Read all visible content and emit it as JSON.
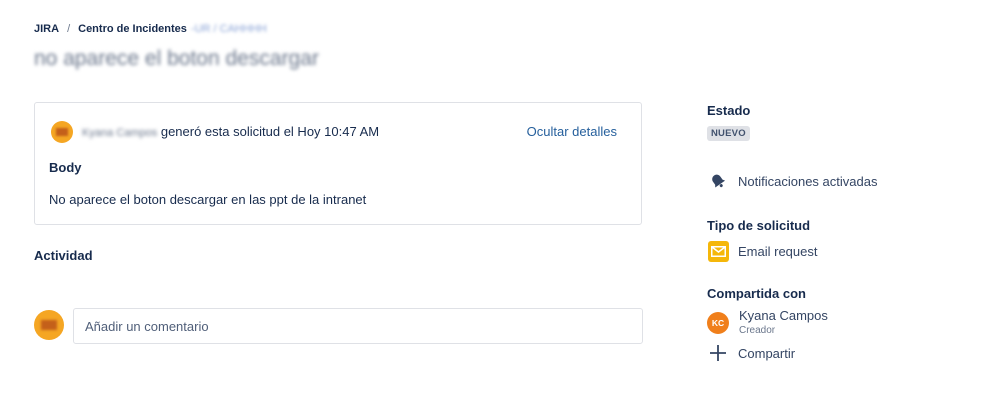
{
  "breadcrumb": {
    "root": "JIRA",
    "separator": "/",
    "project": "Centro de Incidentes",
    "project_suffix_redacted": "-UR / CAHHHH"
  },
  "request": {
    "title_redacted": "no aparece el boton descargar",
    "reporter_redacted": "Kyana Campos",
    "created_text": "generó esta solicitud el Hoy 10:47 AM",
    "toggle_details": "Ocultar detalles",
    "body_heading": "Body",
    "body_text": "No aparece el boton descargar en las ppt de la intranet"
  },
  "activity": {
    "heading": "Actividad",
    "comment_placeholder": "Añadir un comentario"
  },
  "sidebar": {
    "status_heading": "Estado",
    "status_value": "NUEVO",
    "notifications_label": "Notificaciones activadas",
    "request_type_heading": "Tipo de solicitud",
    "request_type_value": "Email request",
    "shared_heading": "Compartida con",
    "shared_person": {
      "initials": "KC",
      "name": "Kyana Campos",
      "role": "Creador"
    },
    "share_label": "Compartir"
  },
  "icons": {
    "notifications": "bell-icon",
    "request_type": "email-icon",
    "share": "plus-icon"
  },
  "colors": {
    "link": "#255f9c",
    "text": "#172b4d",
    "badge_bg": "#dfe1e6",
    "email_icon": "#f5b70a",
    "avatar": "#f07f1b"
  }
}
